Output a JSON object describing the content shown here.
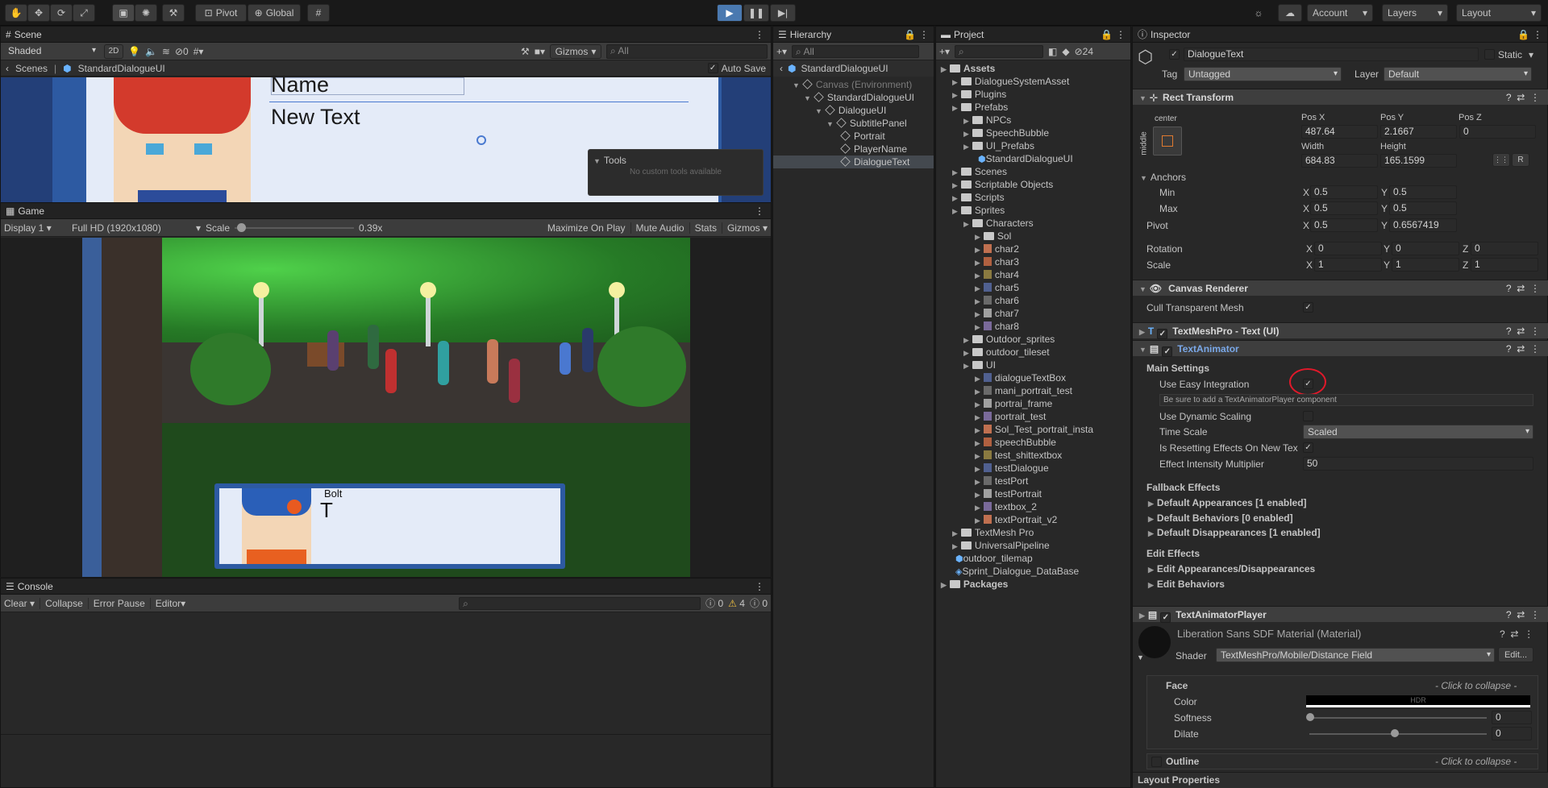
{
  "toolbar": {
    "pivot": "Pivot",
    "global": "Global",
    "account": "Account",
    "layers": "Layers",
    "layout": "Layout"
  },
  "scene": {
    "tab": "Scene",
    "shade": "Shaded",
    "twod": "2D",
    "hidden_count": "0",
    "gizmos": "Gizmos",
    "search_placeholder": "All",
    "breadcrumb_root": "Scenes",
    "breadcrumb_prefab": "StandardDialogueUI",
    "auto_save": "Auto Save",
    "preview_name": "Name",
    "preview_text": "New Text",
    "tools_title": "Tools",
    "tools_empty": "No custom tools available"
  },
  "game": {
    "tab": "Game",
    "display": "Display 1",
    "resolution": "Full HD (1920x1080)",
    "scale_label": "Scale",
    "scale_value": "0.39x",
    "maximize": "Maximize On Play",
    "mute": "Mute Audio",
    "stats": "Stats",
    "gizmos": "Gizmos",
    "speaker": "Bolt",
    "dialogue": "T",
    "scale_fraction": 0.02
  },
  "console": {
    "tab": "Console",
    "clear": "Clear",
    "collapse": "Collapse",
    "error_pause": "Error Pause",
    "editor": "Editor",
    "count_log": "0",
    "count_warn": "4",
    "count_error": "0"
  },
  "hierarchy": {
    "tab": "Hierarchy",
    "search_placeholder": "All",
    "root": "StandardDialogueUI",
    "items": [
      {
        "label": "Canvas (Environment)",
        "indent": 1,
        "dim": true
      },
      {
        "label": "StandardDialogueUI",
        "indent": 2
      },
      {
        "label": "DialogueUI",
        "indent": 3
      },
      {
        "label": "SubtitlePanel",
        "indent": 4
      },
      {
        "label": "Portrait",
        "indent": 5
      },
      {
        "label": "PlayerName",
        "indent": 5
      },
      {
        "label": "DialogueText",
        "indent": 5,
        "selected": true
      }
    ]
  },
  "project": {
    "tab": "Project",
    "count": "24",
    "items": [
      {
        "label": "Assets",
        "indent": 0,
        "bold": true,
        "type": "folder"
      },
      {
        "label": "DialogueSystemAsset",
        "indent": 1,
        "type": "folder"
      },
      {
        "label": "Plugins",
        "indent": 1,
        "type": "folder"
      },
      {
        "label": "Prefabs",
        "indent": 1,
        "type": "folder"
      },
      {
        "label": "NPCs",
        "indent": 2,
        "type": "folder"
      },
      {
        "label": "SpeechBubble",
        "indent": 2,
        "type": "folder"
      },
      {
        "label": "UI_Prefabs",
        "indent": 2,
        "type": "folder"
      },
      {
        "label": "StandardDialogueUI",
        "indent": 3,
        "type": "prefab"
      },
      {
        "label": "Scenes",
        "indent": 1,
        "type": "folder"
      },
      {
        "label": "Scriptable Objects",
        "indent": 1,
        "type": "folder"
      },
      {
        "label": "Scripts",
        "indent": 1,
        "type": "folder"
      },
      {
        "label": "Sprites",
        "indent": 1,
        "type": "folder"
      },
      {
        "label": "Characters",
        "indent": 2,
        "type": "folder"
      },
      {
        "label": "Sol",
        "indent": 3,
        "type": "folder"
      },
      {
        "label": "char2",
        "indent": 3,
        "type": "sprite"
      },
      {
        "label": "char3",
        "indent": 3,
        "type": "sprite"
      },
      {
        "label": "char4",
        "indent": 3,
        "type": "sprite"
      },
      {
        "label": "char5",
        "indent": 3,
        "type": "sprite"
      },
      {
        "label": "char6",
        "indent": 3,
        "type": "sprite"
      },
      {
        "label": "char7",
        "indent": 3,
        "type": "sprite"
      },
      {
        "label": "char8",
        "indent": 3,
        "type": "sprite"
      },
      {
        "label": "Outdoor_sprites",
        "indent": 2,
        "type": "folder"
      },
      {
        "label": "outdoor_tileset",
        "indent": 2,
        "type": "folder"
      },
      {
        "label": "UI",
        "indent": 2,
        "type": "folder"
      },
      {
        "label": "dialogueTextBox",
        "indent": 3,
        "type": "sprite"
      },
      {
        "label": "mani_portrait_test",
        "indent": 3,
        "type": "sprite"
      },
      {
        "label": "portrai_frame",
        "indent": 3,
        "type": "sprite"
      },
      {
        "label": "portrait_test",
        "indent": 3,
        "type": "sprite"
      },
      {
        "label": "Sol_Test_portrait_insta",
        "indent": 3,
        "type": "sprite"
      },
      {
        "label": "speechBubble",
        "indent": 3,
        "type": "sprite"
      },
      {
        "label": "test_shittextbox",
        "indent": 3,
        "type": "sprite"
      },
      {
        "label": "testDialogue",
        "indent": 3,
        "type": "sprite"
      },
      {
        "label": "testPort",
        "indent": 3,
        "type": "sprite"
      },
      {
        "label": "testPortrait",
        "indent": 3,
        "type": "sprite"
      },
      {
        "label": "textbox_2",
        "indent": 3,
        "type": "sprite"
      },
      {
        "label": "textPortrait_v2",
        "indent": 3,
        "type": "sprite"
      },
      {
        "label": "TextMesh Pro",
        "indent": 1,
        "type": "folder"
      },
      {
        "label": "UniversalPipeline",
        "indent": 1,
        "type": "folder"
      },
      {
        "label": "outdoor_tilemap",
        "indent": 1,
        "type": "prefab"
      },
      {
        "label": "Sprint_Dialogue_DataBase",
        "indent": 1,
        "type": "asset"
      },
      {
        "label": "Packages",
        "indent": 0,
        "bold": true,
        "type": "folder"
      }
    ]
  },
  "inspector": {
    "tab": "Inspector",
    "object_name": "DialogueText",
    "static": "Static",
    "tag_label": "Tag",
    "tag": "Untagged",
    "layer_label": "Layer",
    "layer": "Default",
    "rect_title": "Rect Transform",
    "anchor_h": "center",
    "anchor_v": "middle",
    "pos_x_label": "Pos X",
    "pos_y_label": "Pos Y",
    "pos_z_label": "Pos Z",
    "pos_x": "487.64",
    "pos_y": "2.1667",
    "pos_z": "0",
    "width_label": "Width",
    "height_label": "Height",
    "width": "684.83",
    "height": "165.1599",
    "r_btn": "R",
    "anchors": "Anchors",
    "min": "Min",
    "max": "Max",
    "pivot": "Pivot",
    "rotation": "Rotation",
    "scale": "Scale",
    "x": "X",
    "y": "Y",
    "z": "Z",
    "min_x": "0.5",
    "min_y": "0.5",
    "max_x": "0.5",
    "max_y": "0.5",
    "pivot_x": "0.5",
    "pivot_y": "0.6567419",
    "rot_x": "0",
    "rot_y": "0",
    "rot_z": "0",
    "scale_x": "1",
    "scale_y": "1",
    "scale_z": "1",
    "canvas_renderer": "Canvas Renderer",
    "cull": "Cull Transparent Mesh",
    "tmp": "TextMeshPro - Text (UI)",
    "animator": "TextAnimator",
    "main_settings": "Main Settings",
    "easy": "Use Easy Integration",
    "easy_help": "Be sure to add a TextAnimatorPlayer component",
    "dynamic": "Use Dynamic Scaling",
    "timescale_label": "Time Scale",
    "timescale": "Scaled",
    "resetting": "Is Resetting Effects On New Tex",
    "intensity_label": "Effect Intensity Multiplier",
    "intensity": "50",
    "fallback": "Fallback Effects",
    "def_app": "Default Appearances [1 enabled]",
    "def_beh": "Default Behaviors [0 enabled]",
    "def_dis": "Default Disappearances [1 enabled]",
    "edit_effects": "Edit Effects",
    "edit_app": "Edit Appearances/Disappearances",
    "edit_beh": "Edit Behaviors",
    "player": "TextAnimatorPlayer",
    "material": "Liberation Sans SDF Material (Material)",
    "shader_label": "Shader",
    "shader": "TextMeshPro/Mobile/Distance Field",
    "edit_btn": "Edit...",
    "face": "Face",
    "collapse_hint": "- Click to collapse -",
    "color": "Color",
    "hdr": "HDR",
    "softness": "Softness",
    "softness_val": "0",
    "dilate": "Dilate",
    "dilate_val": "0",
    "softness_level": 0.0,
    "dilate_level": 0.5,
    "outline": "Outline",
    "layout_props": "Layout Properties"
  },
  "colors": {
    "accent": "#4a79b0",
    "selection": "#2c5d87",
    "highlight_red": "#e0192a",
    "panel": "#282828"
  }
}
